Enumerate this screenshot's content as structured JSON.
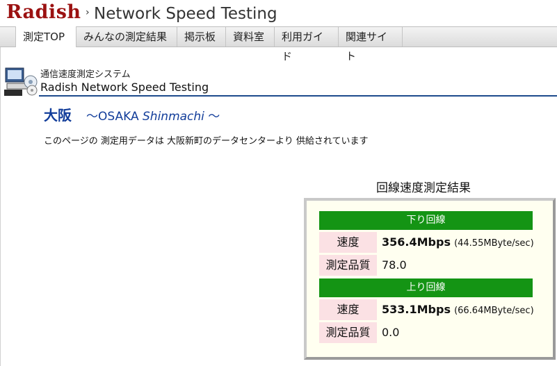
{
  "header": {
    "logo": "Radish",
    "title": "Network Speed Testing"
  },
  "nav": [
    {
      "label": "測定TOP",
      "active": true
    },
    {
      "label": "みんなの測定結果"
    },
    {
      "label": "掲示板"
    },
    {
      "label": "資料室"
    },
    {
      "label": "利用ガイド"
    },
    {
      "label": "関連サイト"
    }
  ],
  "system": {
    "subtitle": "通信速度測定システム",
    "name": "Radish Network Speed Testing",
    "icon": "computer-disc-icon"
  },
  "location": {
    "city": "大阪",
    "sub_prefix": "～OSAKA ",
    "sub_italic": "Shinmachi",
    "sub_suffix": " ～",
    "description": "このページの 測定用データは 大阪新町のデータセンターより 供給されています"
  },
  "results": {
    "title": "回線速度測定結果",
    "download": {
      "header": "下り回線",
      "speed_label": "速度",
      "speed_value": "356.4Mbps",
      "speed_detail": "(44.55MByte/sec)",
      "quality_label": "測定品質",
      "quality_value": "78.0"
    },
    "upload": {
      "header": "上り回線",
      "speed_label": "速度",
      "speed_value": "533.1Mbps",
      "speed_detail": "(66.64MByte/sec)",
      "quality_label": "測定品質",
      "quality_value": "0.0"
    }
  },
  "colors": {
    "logo": "#9b1111",
    "accent_blue": "#123d9a",
    "band_green": "#149414",
    "label_pink": "#fbe1e4",
    "box_bg": "#fffff0"
  }
}
